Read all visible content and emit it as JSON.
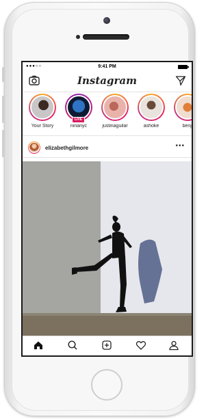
{
  "status_bar": {
    "signal": "●●●○○",
    "time": "9:41 PM"
  },
  "nav": {
    "logo": "Instagram",
    "camera_icon": "camera-icon",
    "direct_icon": "paper-plane-icon"
  },
  "stories": [
    {
      "name": "Your Story",
      "live": false
    },
    {
      "name": "ninanyc",
      "live": true,
      "badge": "LIVE"
    },
    {
      "name": "justinaguilar",
      "live": false
    },
    {
      "name": "ashoke",
      "live": false
    },
    {
      "name": "benji",
      "live": false
    }
  ],
  "post": {
    "username": "elizabethgilmore",
    "more": "•••"
  },
  "tab_bar": {
    "icons": [
      "home-icon",
      "search-icon",
      "add-post-icon",
      "heart-icon",
      "profile-icon"
    ]
  },
  "colors": {
    "story_ring": "#e91e63",
    "live_ring": "#8e24aa",
    "live_badge": "#d81b60",
    "wall_gray": "#a5a6a1",
    "wall_white": "#e5e6ea"
  }
}
